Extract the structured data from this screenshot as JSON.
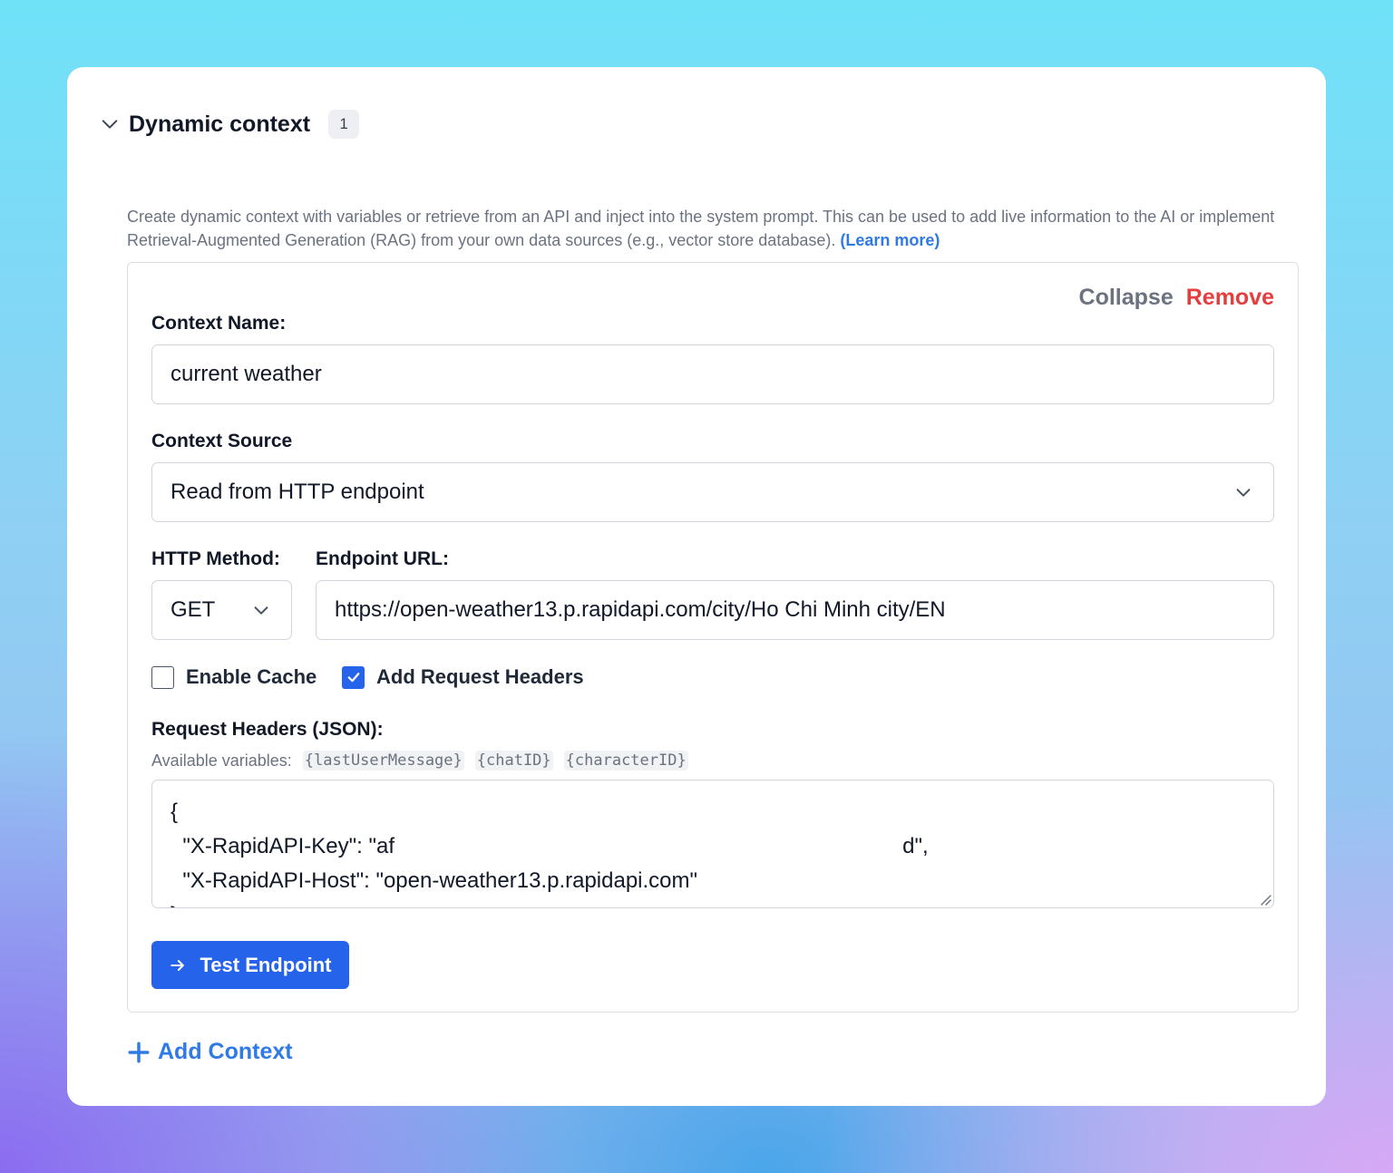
{
  "section": {
    "title": "Dynamic context",
    "count": "1",
    "description": "Create dynamic context with variables or retrieve from an API and inject into the system prompt. This can be used to add live information to the AI or implement Retrieval-Augmented Generation (RAG) from your own data sources (e.g., vector store database).",
    "learn_more": "(Learn more)"
  },
  "context_card": {
    "collapse_label": "Collapse",
    "remove_label": "Remove",
    "name_label": "Context Name:",
    "name_value": "current weather",
    "source_label": "Context Source",
    "source_value": "Read from HTTP endpoint",
    "method_label": "HTTP Method:",
    "method_value": "GET",
    "url_label": "Endpoint URL:",
    "url_value": "https://open-weather13.p.rapidapi.com/city/Ho Chi Minh city/EN",
    "enable_cache_label": "Enable Cache",
    "enable_cache_checked": false,
    "add_headers_label": "Add Request Headers",
    "add_headers_checked": true,
    "headers_label": "Request Headers (JSON):",
    "variables_label": "Available variables:",
    "variables": [
      "{lastUserMessage}",
      "{chatID}",
      "{characterID}"
    ],
    "headers_value": "{\n  \"X-RapidAPI-Key\": \"af                                                                                    d\",\n  \"X-RapidAPI-Host\": \"open-weather13.p.rapidapi.com\"\n}",
    "test_button_label": "Test Endpoint"
  },
  "add_context_label": "Add Context",
  "colors": {
    "primary": "#2563eb",
    "link": "#2f7ae5",
    "danger": "#e53e3e",
    "muted": "#6b7280"
  },
  "icons": [
    "chevron-down-icon",
    "arrow-right-icon",
    "plus-icon",
    "check-icon"
  ]
}
